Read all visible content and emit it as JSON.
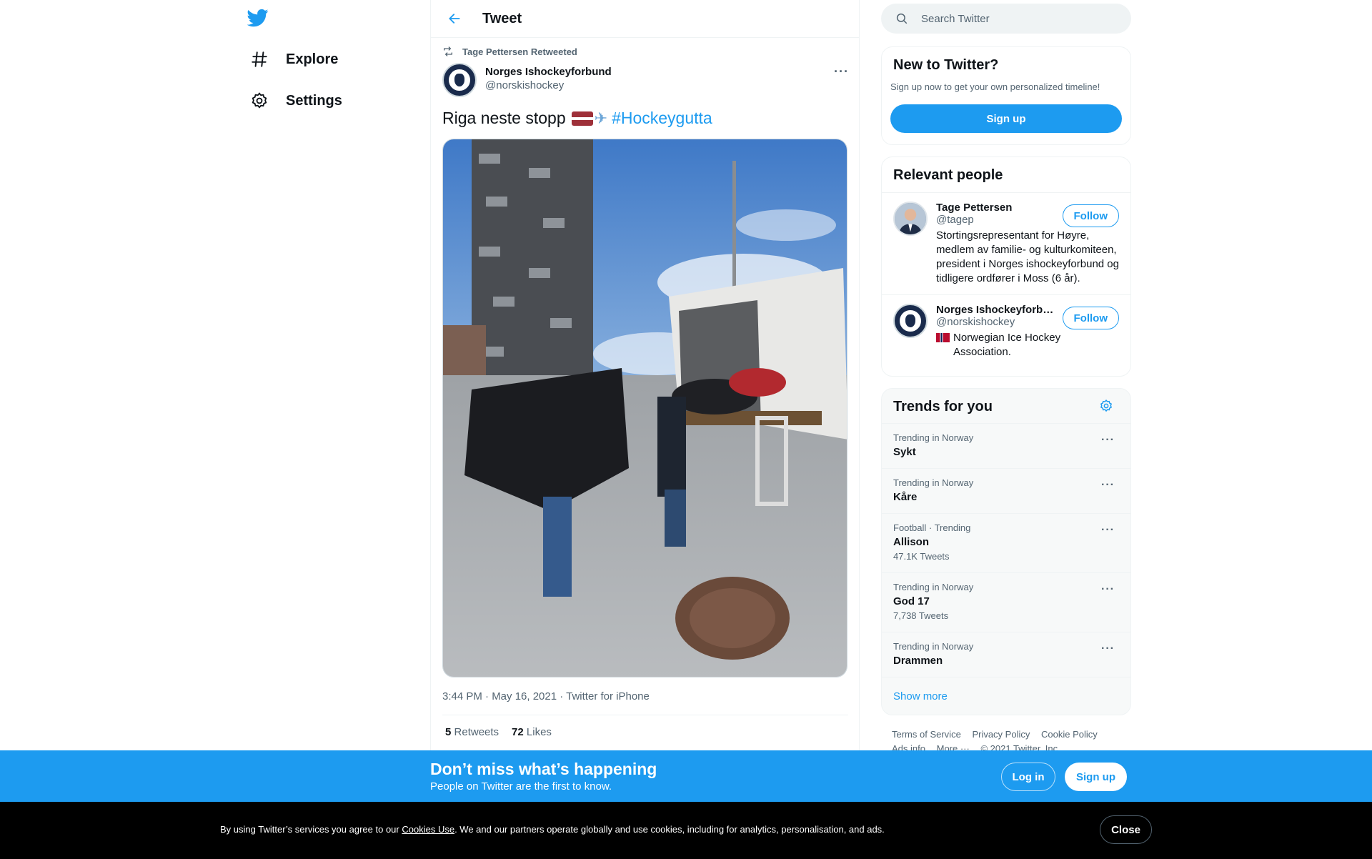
{
  "nav": {
    "explore_label": "Explore",
    "settings_label": "Settings"
  },
  "header": {
    "title": "Tweet"
  },
  "tweet": {
    "retweeted_by": "Tage Pettersen Retweeted",
    "author_name": "Norges Ishockeyforbund",
    "author_handle": "@norskishockey",
    "text": "Riga neste stopp",
    "hashtag": "#Hockeygutta",
    "meta": "3:44 PM · May 16, 2021 · Twitter for iPhone",
    "retweets_count": "5",
    "retweets_label": "Retweets",
    "likes_count": "72",
    "likes_label": "Likes"
  },
  "search": {
    "placeholder": "Search Twitter"
  },
  "new_to_twitter": {
    "title": "New to Twitter?",
    "subtitle": "Sign up now to get your own personalized timeline!",
    "button": "Sign up"
  },
  "relevant_people": {
    "title": "Relevant people",
    "people": [
      {
        "name": "Tage Pettersen",
        "handle": "@tagep",
        "bio": "Stortingsrepresentant for Høyre, medlem av familie- og kulturkomiteen, president i Norges ishockeyforbund og tidligere ordfører i Moss (6 år).",
        "follow": "Follow"
      },
      {
        "name": "Norges Ishockeyforbund",
        "handle": "@norskishockey",
        "bio": "Norwegian Ice Hockey Association.",
        "follow": "Follow"
      }
    ]
  },
  "trends": {
    "title": "Trends for you",
    "items": [
      {
        "category": "Trending in Norway",
        "name": "Sykt",
        "count": ""
      },
      {
        "category": "Trending in Norway",
        "name": "Kåre",
        "count": ""
      },
      {
        "category": "Football · Trending",
        "name": "Allison",
        "count": "47.1K Tweets"
      },
      {
        "category": "Trending in Norway",
        "name": "God 17",
        "count": "7,738 Tweets"
      },
      {
        "category": "Trending in Norway",
        "name": "Drammen",
        "count": ""
      }
    ],
    "show_more": "Show more"
  },
  "footer": {
    "terms": "Terms of Service",
    "privacy": "Privacy Policy",
    "cookie": "Cookie Policy",
    "ads": "Ads info",
    "more": "More ···",
    "copyright": "© 2021 Twitter, Inc."
  },
  "banner": {
    "title": "Don’t miss what’s happening",
    "subtitle": "People on Twitter are the first to know.",
    "login": "Log in",
    "signup": "Sign up"
  },
  "cookie_bar": {
    "text_before": "By using Twitter’s services you agree to our ",
    "link": "Cookies Use",
    "text_after": ". We and our partners operate globally and use cookies, including for analytics, personalisation, and ads.",
    "close": "Close"
  },
  "colors": {
    "accent": "#1d9bf0",
    "text": "#0f1419",
    "muted": "#536471"
  }
}
